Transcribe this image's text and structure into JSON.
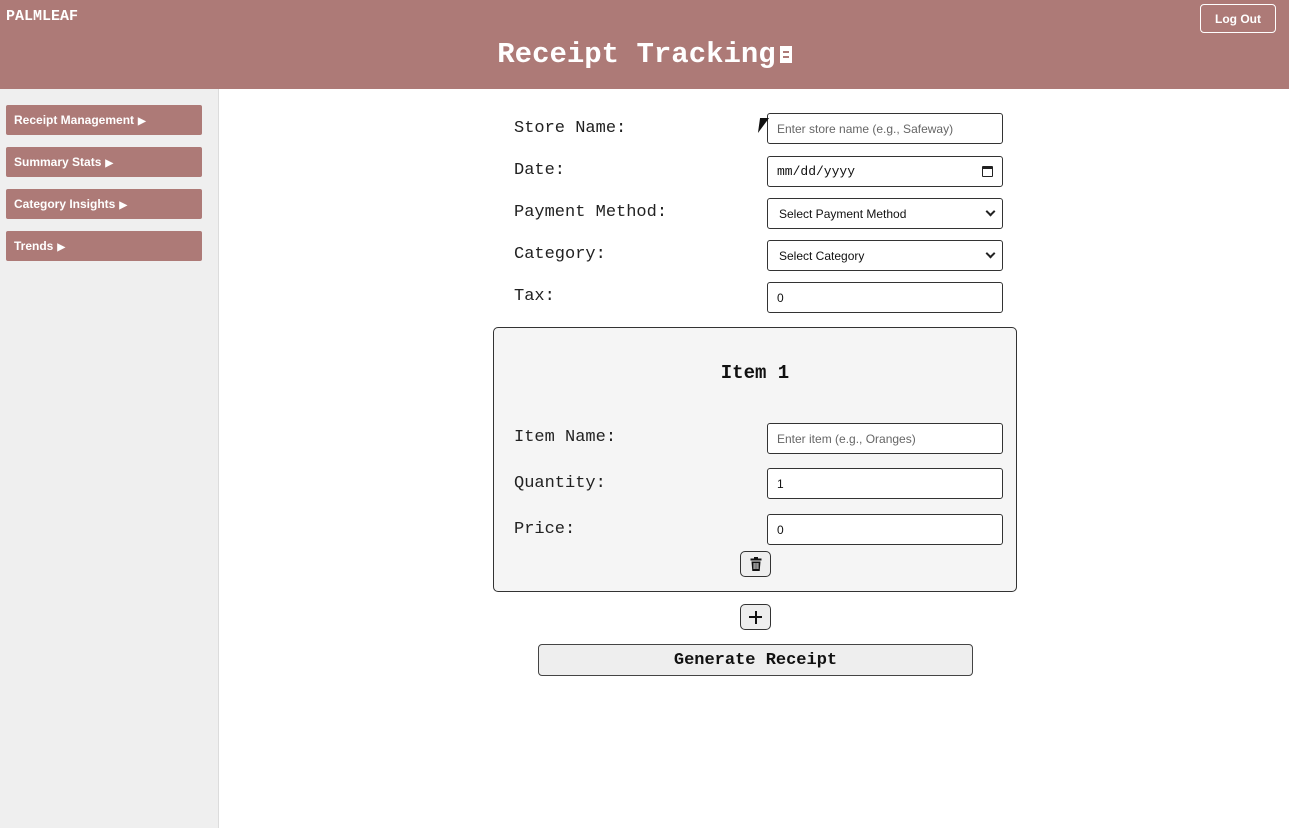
{
  "header": {
    "brand": "PALMLEAF",
    "title": "Receipt Tracking",
    "title_icon": "receipt-icon",
    "logout_label": "Log Out"
  },
  "sidebar": {
    "items": [
      {
        "label": "Receipt Management",
        "arrow": "▶"
      },
      {
        "label": "Summary Stats",
        "arrow": "▶"
      },
      {
        "label": "Category Insights",
        "arrow": "▶"
      },
      {
        "label": "Trends",
        "arrow": "▶"
      }
    ]
  },
  "form": {
    "store": {
      "label": "Store Name:",
      "placeholder": "Enter store name (e.g., Safeway)",
      "value": ""
    },
    "date": {
      "label": "Date:",
      "value": "mm/dd/yyyy"
    },
    "payment": {
      "label": "Payment Method:",
      "selected": "Select Payment Method"
    },
    "category": {
      "label": "Category:",
      "selected": "Select Category"
    },
    "tax": {
      "label": "Tax:",
      "value": "0"
    }
  },
  "items": [
    {
      "title": "Item 1",
      "name": {
        "label": "Item Name:",
        "placeholder": "Enter item (e.g., Oranges)",
        "value": ""
      },
      "quantity": {
        "label": "Quantity:",
        "value": "1"
      },
      "price": {
        "label": "Price:",
        "value": "0"
      },
      "delete_icon": "trash-icon"
    }
  ],
  "add_item_icon": "plus-icon",
  "generate_label": "Generate Receipt",
  "colors": {
    "accent": "#ad7a77",
    "sidebar_bg": "#efefef",
    "card_bg": "#f5f5f5"
  }
}
